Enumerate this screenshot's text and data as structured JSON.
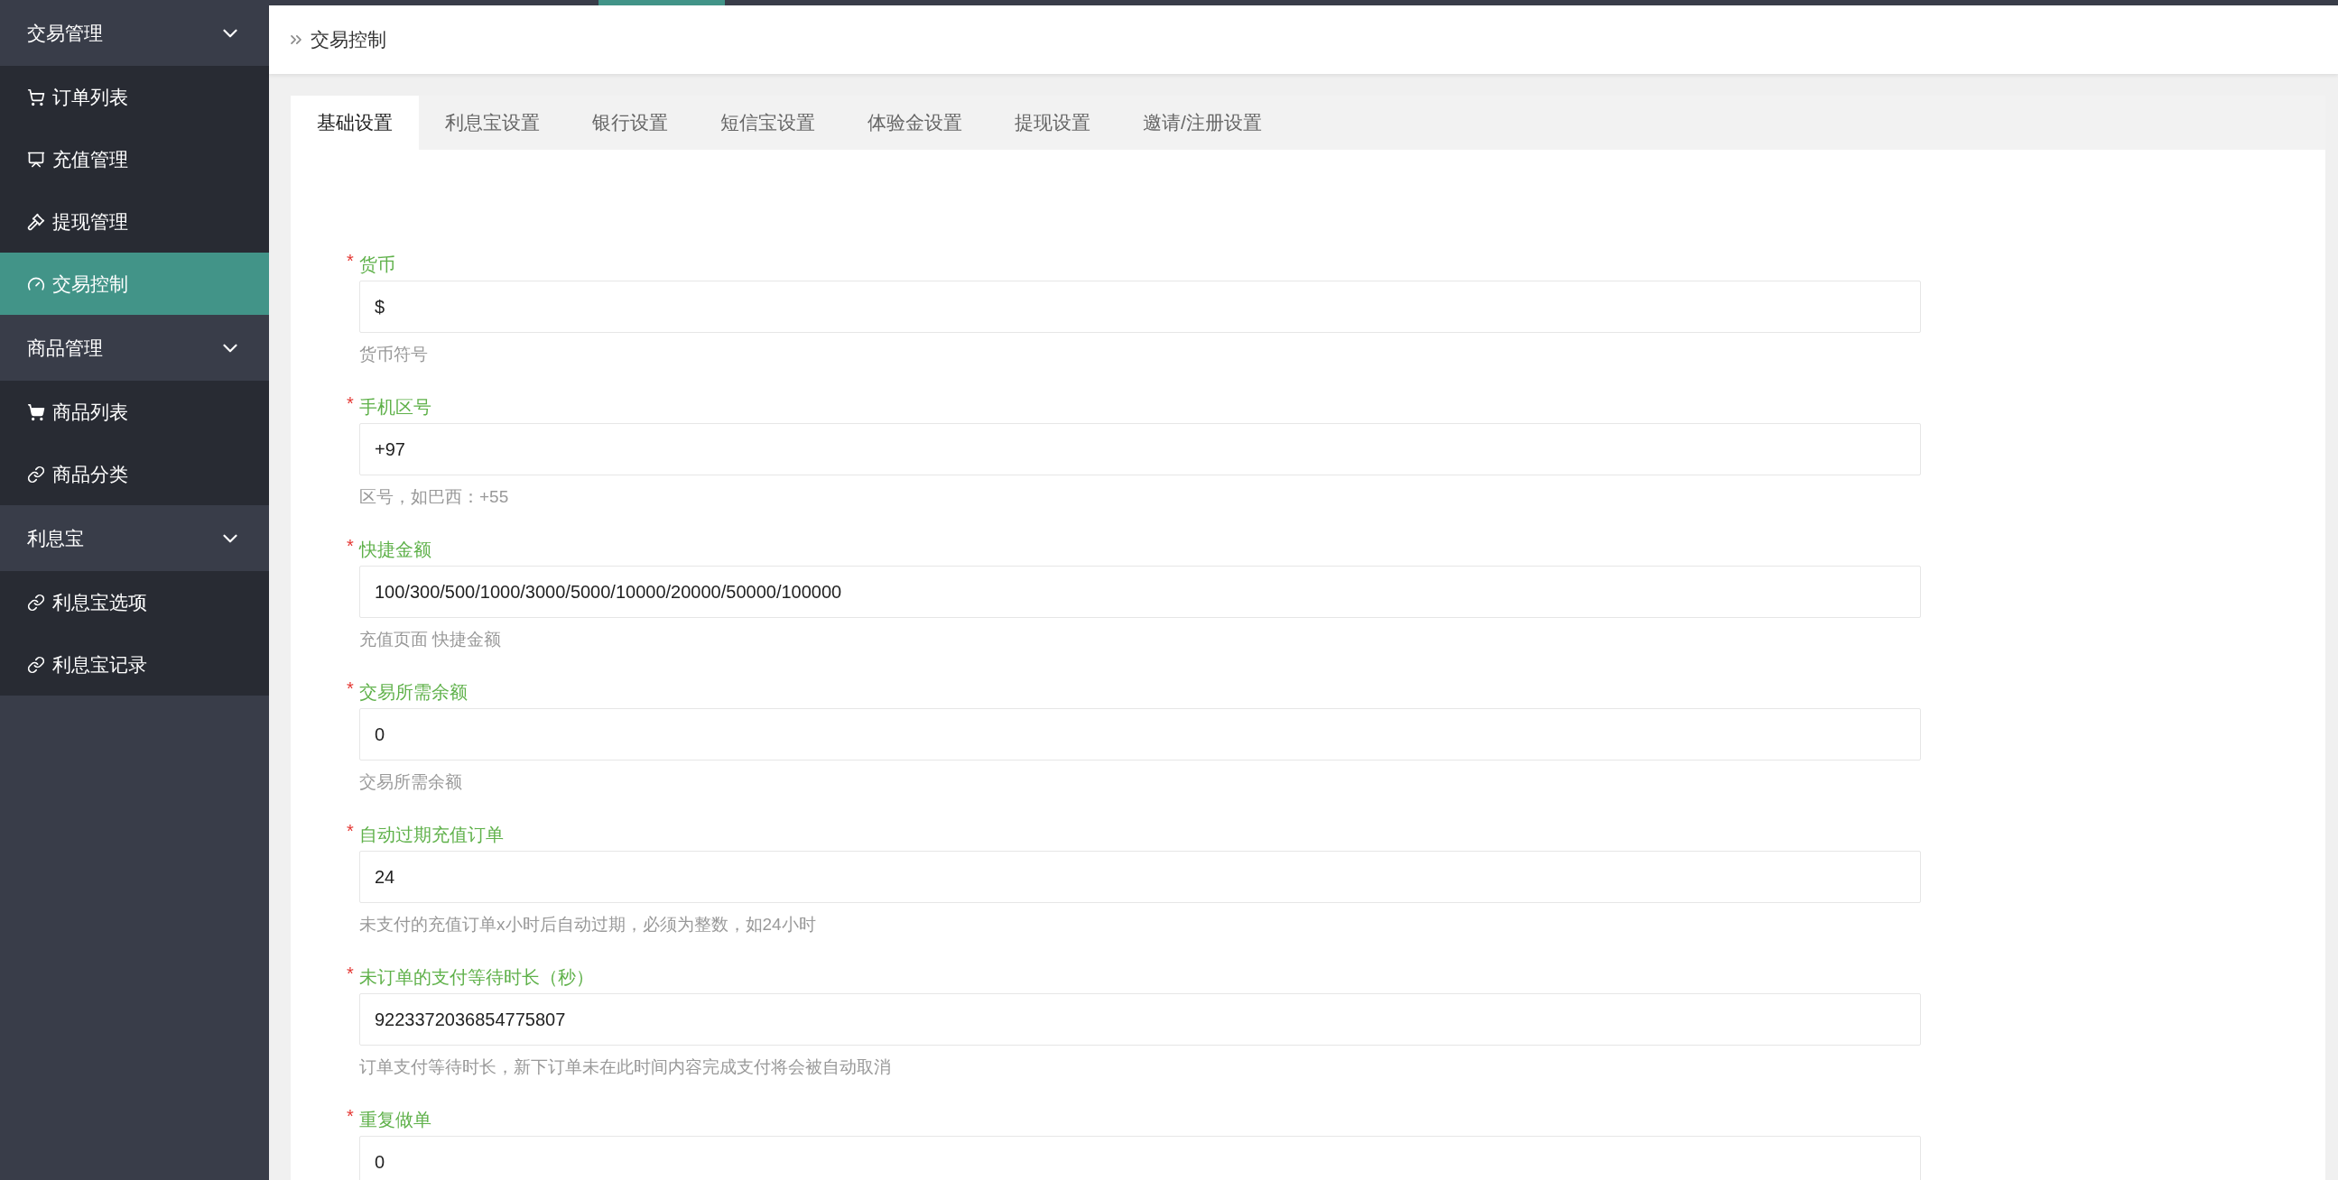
{
  "sidebar": {
    "groups": [
      {
        "title": "交易管理",
        "expanded": true,
        "items": [
          {
            "label": "订单列表",
            "kind": "cart",
            "selected": false
          },
          {
            "label": "充值管理",
            "kind": "board",
            "selected": false
          },
          {
            "label": "提现管理",
            "kind": "gavel",
            "selected": false
          },
          {
            "label": "交易控制",
            "kind": "gauge",
            "selected": true
          }
        ]
      },
      {
        "title": "商品管理",
        "expanded": true,
        "items": [
          {
            "label": "商品列表",
            "kind": "cartfill",
            "selected": false
          },
          {
            "label": "商品分类",
            "kind": "link",
            "selected": false
          }
        ]
      },
      {
        "title": "利息宝",
        "expanded": true,
        "items": [
          {
            "label": "利息宝选项",
            "kind": "link",
            "selected": false
          },
          {
            "label": "利息宝记录",
            "kind": "link",
            "selected": false
          }
        ]
      }
    ]
  },
  "breadcrumb": "交易控制",
  "tabs": [
    {
      "label": "基础设置",
      "selected": true
    },
    {
      "label": "利息宝设置",
      "selected": false
    },
    {
      "label": "银行设置",
      "selected": false
    },
    {
      "label": "短信宝设置",
      "selected": false
    },
    {
      "label": "体验金设置",
      "selected": false
    },
    {
      "label": "提现设置",
      "selected": false
    },
    {
      "label": "邀请/注册设置",
      "selected": false
    }
  ],
  "fields": [
    {
      "label": "货币",
      "marker": "*",
      "value": "$",
      "help": "货币符号"
    },
    {
      "label": "手机区号",
      "marker": "*",
      "value": "+97",
      "help": "区号，如巴西：+55"
    },
    {
      "label": "快捷金额",
      "marker": "*",
      "value": "100/300/500/1000/3000/5000/10000/20000/50000/100000",
      "help": "充值页面 快捷金额"
    },
    {
      "label": "交易所需余额",
      "marker": "*",
      "value": "0",
      "help": "交易所需余额"
    },
    {
      "label": "自动过期充值订单",
      "marker": "*",
      "value": "24",
      "help": "未支付的充值订单x小时后自动过期，必须为整数，如24小时"
    },
    {
      "label": "未订单的支付等待时长（秒）",
      "marker": "*",
      "value": "9223372036854775807",
      "help": "订单支付等待时长，新下订单未在此时间内容完成支付将会被自动取消"
    },
    {
      "label": "重复做单",
      "marker": "*",
      "value": "0"
    }
  ]
}
